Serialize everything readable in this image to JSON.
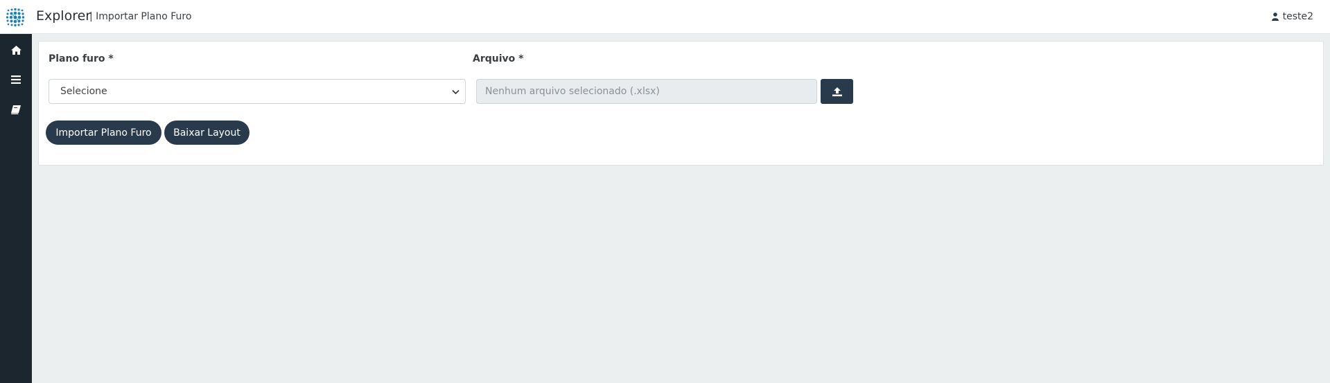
{
  "header": {
    "app_title": "Explorer",
    "page_subtitle": "| Importar Plano Furo",
    "user_name": "teste2"
  },
  "sidebar": {
    "items": [
      {
        "icon": "home-icon"
      },
      {
        "icon": "menu-icon"
      },
      {
        "icon": "book-icon"
      }
    ]
  },
  "form": {
    "plano_label": "Plano furo *",
    "plano_value": "Selecione",
    "arquivo_label": "Arquivo *",
    "arquivo_placeholder": "Nenhum arquivo selecionado  (.xlsx)",
    "import_button": "Importar Plano Furo",
    "download_button": "Baixar Layout"
  },
  "colors": {
    "sidebar_bg": "#1c262f",
    "button_bg": "#2a3a4d",
    "page_bg": "#eceff0",
    "logo_blue": "#1a7fb5"
  }
}
